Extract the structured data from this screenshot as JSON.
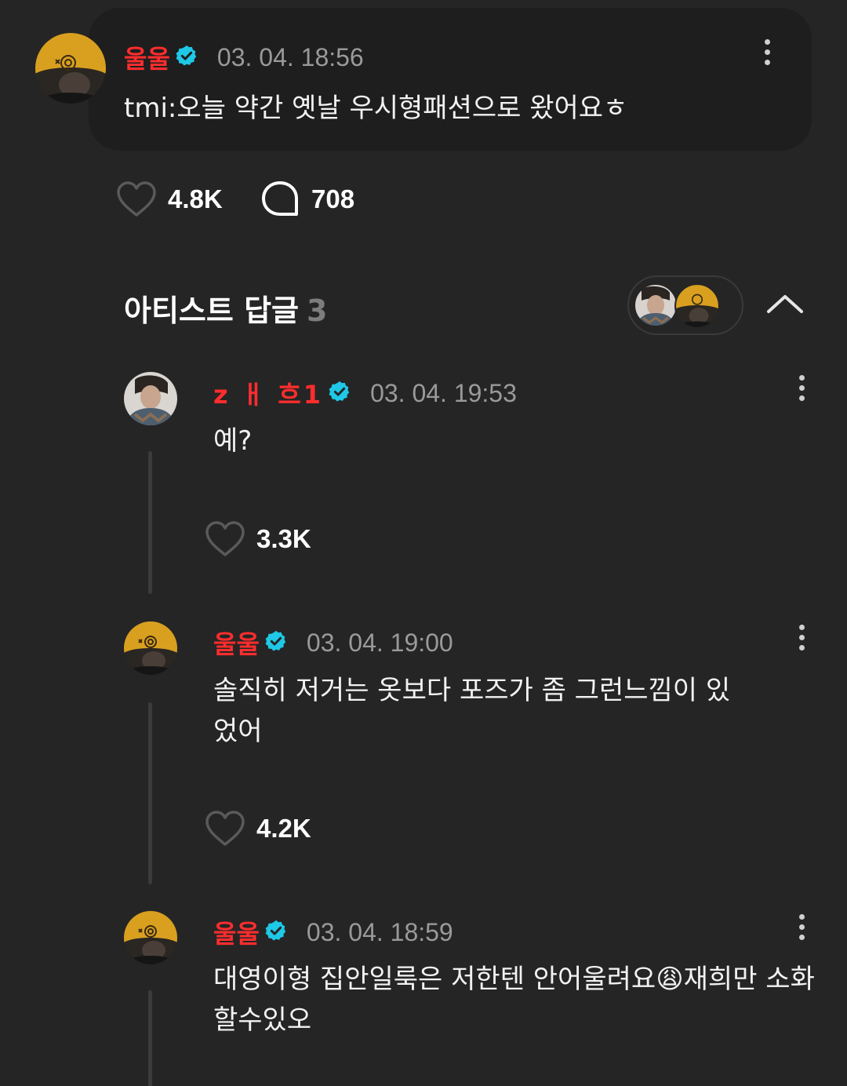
{
  "post": {
    "author": "울울",
    "verified_icon": "verified-check-icon",
    "timestamp": "03. 04. 18:56",
    "text": "tmi:오늘 약간 옛날 우시형패션으로 왔어요ㅎ",
    "likes": "4.8K",
    "comments": "708"
  },
  "artist_replies": {
    "title": "아티스트 답글",
    "count": "3"
  },
  "replies": [
    {
      "author": "z ㅐ 흐1",
      "timestamp": "03. 04. 19:53",
      "text": "예?",
      "likes": "3.3K"
    },
    {
      "author": "울울",
      "timestamp": "03. 04. 19:00",
      "text": "솔직히 저거는 옷보다 포즈가 좀 그런느낌이 있었어",
      "likes": "4.2K"
    },
    {
      "author": "울울",
      "timestamp": "03. 04. 18:59",
      "text_before": "대영이형 집안일룩은 저한텐 안어울려요",
      "emoji": "😩",
      "text_after": "재희만 소화할수있오"
    }
  ],
  "colors": {
    "background": "#252525",
    "card": "#1e1e1e",
    "author_name": "#ff2d2d",
    "verified": "#1ec8e6",
    "muted": "#9a9a9a"
  }
}
